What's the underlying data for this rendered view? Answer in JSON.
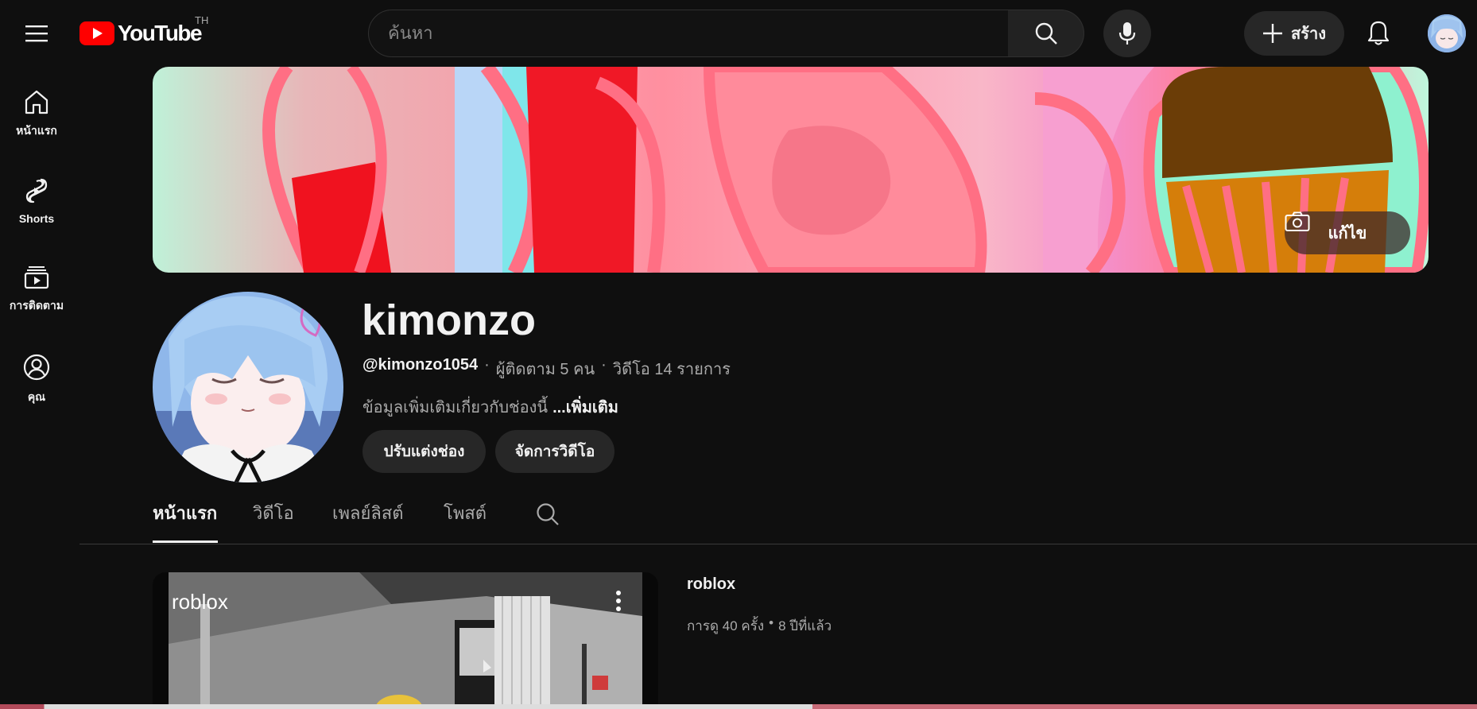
{
  "header": {
    "logo_text": "YouTube",
    "region": "TH",
    "search_placeholder": "ค้นหา",
    "create_label": "สร้าง"
  },
  "sidebar": {
    "items": [
      {
        "label": "หน้าแรก",
        "icon": "home-icon"
      },
      {
        "label": "Shorts",
        "icon": "shorts-icon"
      },
      {
        "label": "การติดตาม",
        "icon": "subscriptions-icon"
      },
      {
        "label": "คุณ",
        "icon": "you-icon"
      }
    ]
  },
  "banner": {
    "edit_label": "แก้ไข"
  },
  "channel": {
    "name": "kimonzo",
    "handle": "@kimonzo1054",
    "separator": "·",
    "subscribers": "ผู้ติดตาม 5 คน",
    "videos": "วิดีโอ 14 รายการ",
    "description": "ข้อมูลเพิ่มเติมเกี่ยวกับช่องนี้",
    "more": "...เพิ่มเติม",
    "customize_label": "ปรับแต่งช่อง",
    "manage_label": "จัดการวิดีโอ"
  },
  "tabs": [
    {
      "label": "หน้าแรก",
      "active": true
    },
    {
      "label": "วิดีโอ",
      "active": false
    },
    {
      "label": "เพลย์ลิสต์",
      "active": false
    },
    {
      "label": "โพสต์",
      "active": false
    }
  ],
  "featured_video": {
    "overlay_title": "roblox",
    "title": "roblox",
    "views": "การดู 40 ครั้ง",
    "dot": "•",
    "age": "8 ปีที่แล้ว"
  },
  "colors": {
    "background": "#0f0f0f",
    "surface": "#272727",
    "text": "#f1f1f1",
    "secondary_text": "#aaaaaa",
    "brand_red": "#ff0000"
  }
}
